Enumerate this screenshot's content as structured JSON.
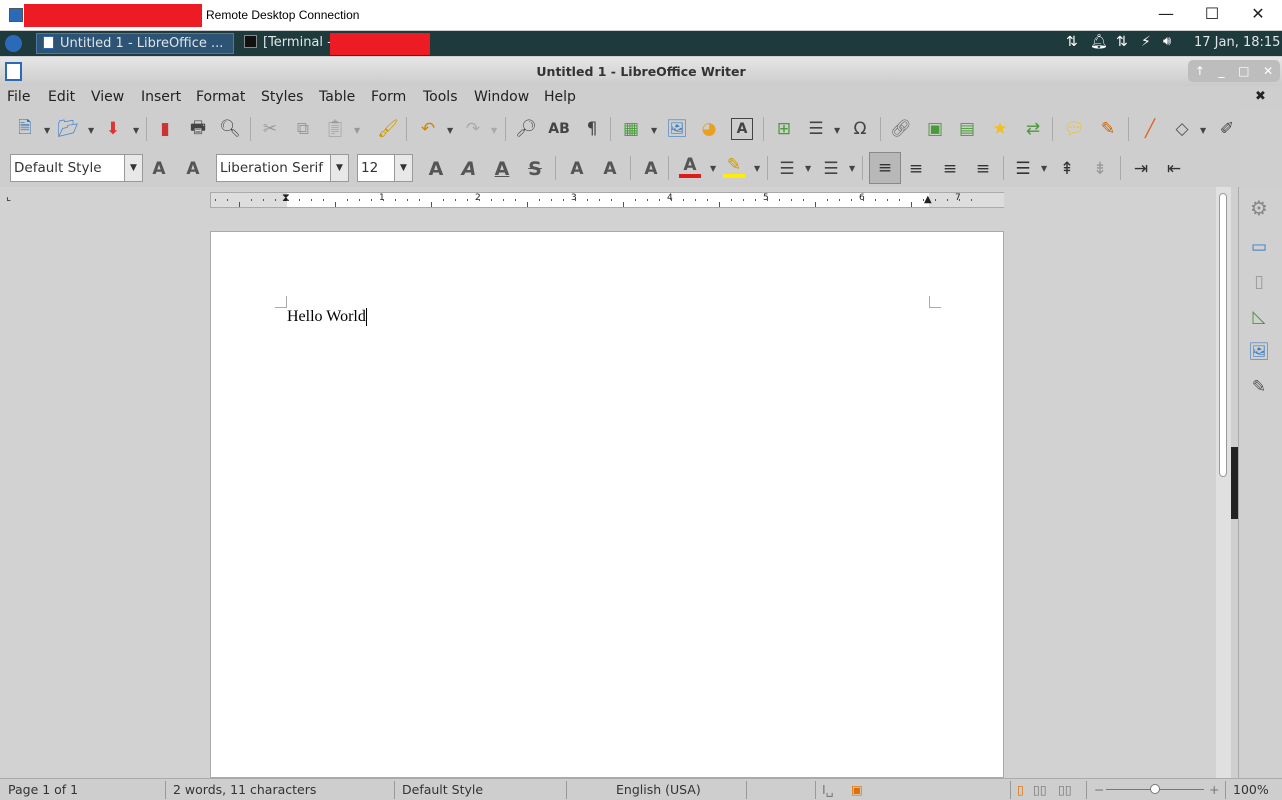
{
  "rdp": {
    "title": "Remote Desktop Connection",
    "minimize": "—",
    "maximize": "☐",
    "close": "✕"
  },
  "taskbar": {
    "tasks": [
      {
        "label": "Untitled 1 - LibreOffice ..."
      },
      {
        "label": "[Terminal -"
      }
    ],
    "clock": "17 Jan, 18:15"
  },
  "window": {
    "title": "Untitled 1 - LibreOffice Writer"
  },
  "menu": [
    "File",
    "Edit",
    "View",
    "Insert",
    "Format",
    "Styles",
    "Table",
    "Form",
    "Tools",
    "Window",
    "Help"
  ],
  "format_bar": {
    "paragraph_style": "Default Style",
    "font_name": "Liberation Serif",
    "font_size": "12"
  },
  "ruler": {
    "labels": [
      "1",
      "2",
      "3",
      "4",
      "5",
      "6",
      "7"
    ]
  },
  "document": {
    "text": "Hello World"
  },
  "status": {
    "page": "Page 1 of 1",
    "words": "2 words, 11 characters",
    "style": "Default Style",
    "language": "English (USA)",
    "zoom": "100%",
    "zoom_level": 100
  },
  "colors": {
    "taskbar": "#1f3a3c",
    "font_color": "#e01b1b",
    "highlight": "#ffee00",
    "accent": "#2a6ab8"
  }
}
